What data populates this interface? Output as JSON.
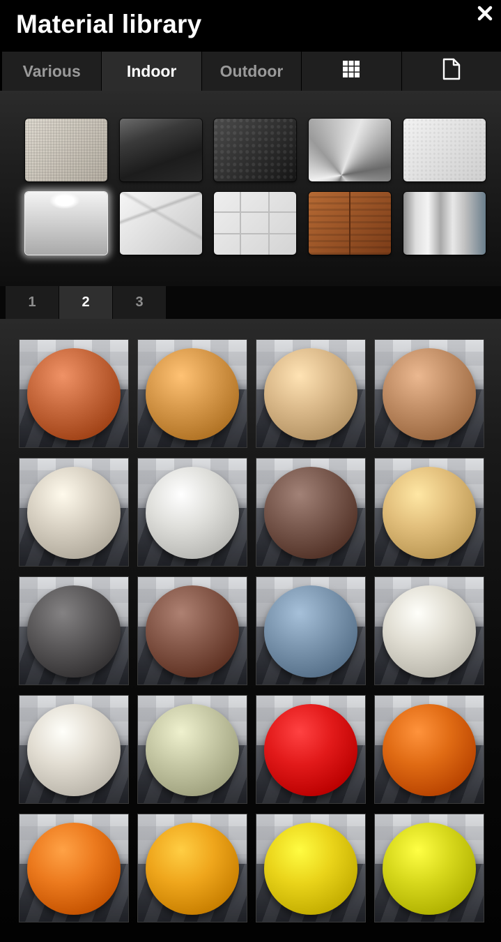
{
  "window": {
    "title": "Material library",
    "close_icon": "close-icon"
  },
  "tabs": [
    {
      "id": "various",
      "label": "Various",
      "active": false
    },
    {
      "id": "indoor",
      "label": "Indoor",
      "active": true
    },
    {
      "id": "outdoor",
      "label": "Outdoor",
      "active": false
    },
    {
      "id": "grid",
      "icon": "grid-icon",
      "active": false
    },
    {
      "id": "file",
      "icon": "file-icon",
      "active": false
    }
  ],
  "swatches": [
    {
      "id": "fabric",
      "name": "fabric-swatch",
      "colors": [
        "#e2ddd3",
        "#b9b2a6"
      ],
      "selected": false
    },
    {
      "id": "black-gloss",
      "name": "black-gloss-swatch",
      "colors": [
        "#6b6b6b",
        "#1c1c1c"
      ],
      "selected": false
    },
    {
      "id": "leather",
      "name": "leather-swatch",
      "colors": [
        "#4a4a4a",
        "#151515"
      ],
      "selected": false
    },
    {
      "id": "brushed-metal",
      "name": "brushed-metal-swatch",
      "colors": [
        "#f0f0f0",
        "#6a6a6a"
      ],
      "selected": false
    },
    {
      "id": "plaster",
      "name": "plaster-swatch",
      "colors": [
        "#f2f2f2",
        "#cfcfcf"
      ],
      "selected": false
    },
    {
      "id": "white-gloss",
      "name": "white-gloss-swatch",
      "colors": [
        "#f4f4f4",
        "#a9a9a9"
      ],
      "selected": true
    },
    {
      "id": "marble",
      "name": "marble-swatch",
      "colors": [
        "#f6f6f6",
        "#c7c7c7"
      ],
      "selected": false
    },
    {
      "id": "tiles",
      "name": "tiles-swatch",
      "colors": [
        "#eeeeee",
        "#d4d4d4"
      ],
      "selected": false
    },
    {
      "id": "wood",
      "name": "wood-swatch",
      "colors": [
        "#b66a34",
        "#7b3c18"
      ],
      "selected": false
    },
    {
      "id": "glass",
      "name": "glass-swatch",
      "colors": [
        "#dedede",
        "#6a7e8c"
      ],
      "selected": false
    }
  ],
  "pages": [
    {
      "label": "1",
      "active": false
    },
    {
      "label": "2",
      "active": true
    },
    {
      "label": "3",
      "active": false
    }
  ],
  "materials": [
    {
      "color": "#c86a3e"
    },
    {
      "color": "#d89a4c"
    },
    {
      "color": "#dcbb8c"
    },
    {
      "color": "#c39068"
    },
    {
      "color": "#d9d2c4"
    },
    {
      "color": "#dfdfdb"
    },
    {
      "color": "#7a5a4f"
    },
    {
      "color": "#e2bf7c"
    },
    {
      "color": "#5c5a5b"
    },
    {
      "color": "#86594a"
    },
    {
      "color": "#7e98b1"
    },
    {
      "color": "#e0ddd2"
    },
    {
      "color": "#e2ddd2"
    },
    {
      "color": "#c7c9a6"
    },
    {
      "color": "#e21a1a"
    },
    {
      "color": "#e06b14"
    },
    {
      "color": "#ec7a1e"
    },
    {
      "color": "#efa61c"
    },
    {
      "color": "#ead41a"
    },
    {
      "color": "#d7d81c"
    }
  ]
}
